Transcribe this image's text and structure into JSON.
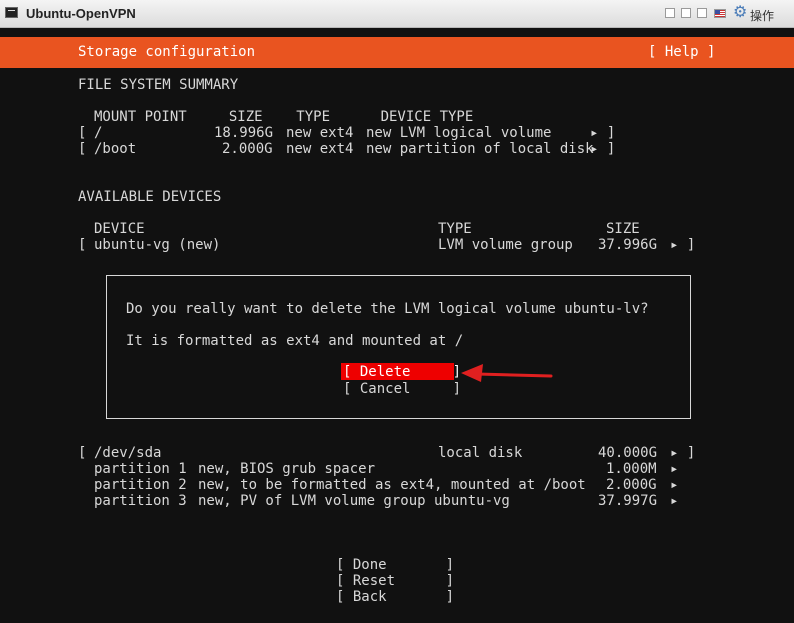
{
  "window": {
    "title": "Ubuntu-OpenVPN",
    "ops_label": "操作"
  },
  "header": {
    "title": "Storage configuration",
    "help": "[ Help ]"
  },
  "fs_summary": {
    "title": "FILE SYSTEM SUMMARY",
    "col_headers": "MOUNT POINT     SIZE    TYPE      DEVICE TYPE",
    "rows": [
      {
        "bracket": "[",
        "mount": "/",
        "size": "18.996G",
        "type": "new ext4",
        "device": "new LVM logical volume",
        "arrow": "▸ ]"
      },
      {
        "bracket": "[",
        "mount": "/boot",
        "size": "2.000G",
        "type": "new ext4",
        "device": "new partition of local disk",
        "arrow": "▸ ]"
      }
    ]
  },
  "available": {
    "title": "AVAILABLE DEVICES",
    "col_device": "DEVICE",
    "col_type": "TYPE",
    "col_size": "SIZE",
    "vg": {
      "bracket": "[",
      "name": "ubuntu-vg (new)",
      "type": "LVM volume group",
      "size": "37.996G",
      "arrow": "▸ ]"
    },
    "sda": {
      "bracket": "[",
      "name": "/dev/sda",
      "type": "local disk",
      "size": "40.000G",
      "arrow": "▸ ]"
    },
    "partitions": [
      {
        "name": "partition 1",
        "desc": "new, BIOS grub spacer",
        "size": "1.000M",
        "arrow": "▸"
      },
      {
        "name": "partition 2",
        "desc": "new, to be formatted as ext4, mounted at /boot",
        "size": "2.000G",
        "arrow": "▸"
      },
      {
        "name": "partition 3",
        "desc": "new, PV of LVM volume group ubuntu-vg",
        "size": "37.997G",
        "arrow": "▸"
      }
    ]
  },
  "dialog": {
    "question": "Do you really want to delete the LVM logical volume ubuntu-lv?",
    "info": "It is formatted as ext4 and mounted at /",
    "delete": "[ Delete     ]",
    "cancel": "[ Cancel     ]"
  },
  "footer": {
    "done": "[ Done       ]",
    "reset": "[ Reset      ]",
    "back": "[ Back       ]"
  },
  "colors": {
    "accent": "#e95420",
    "selection": "#ee0000",
    "annotation_arrow": "#e02020"
  }
}
